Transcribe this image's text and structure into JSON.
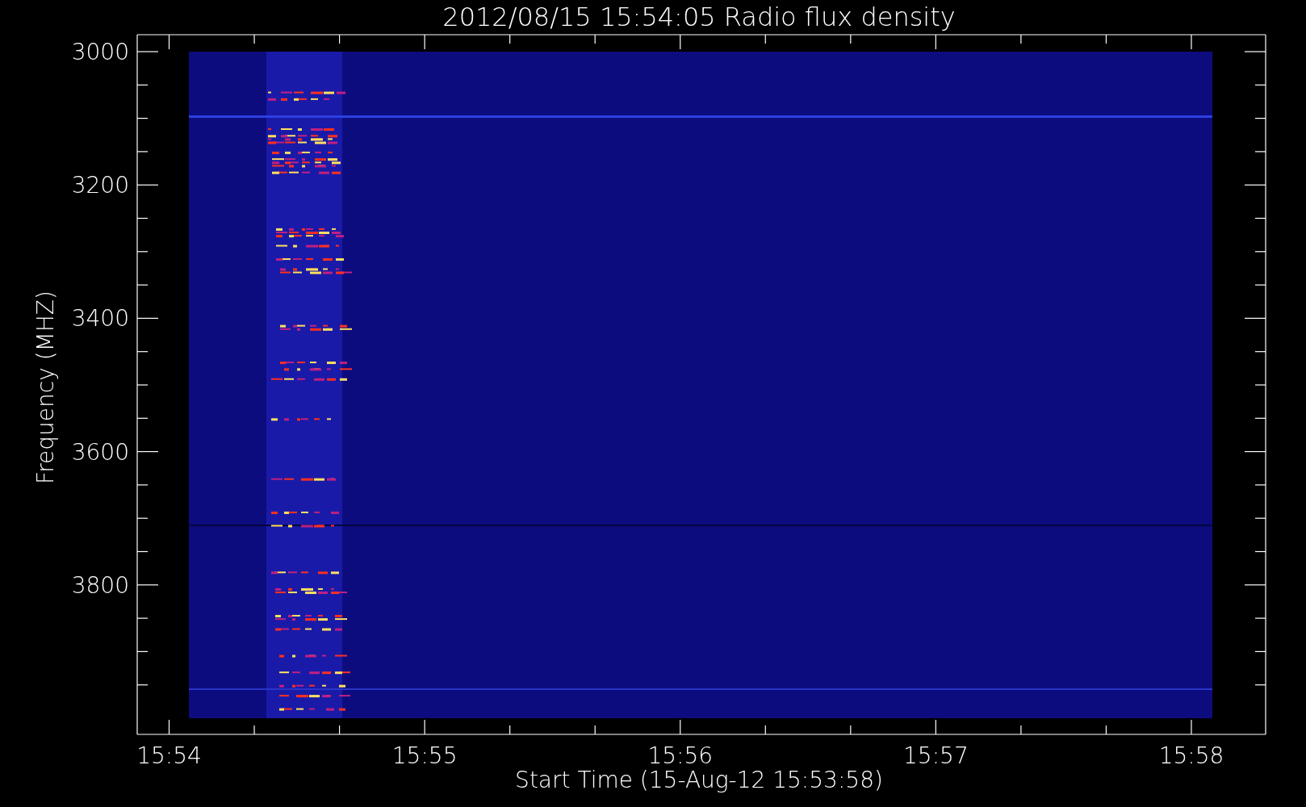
{
  "plot": {
    "title": "2012/08/15 15:54:05 Radio flux density",
    "xlabel": "Start Time (15-Aug-12 15:53:58)",
    "ylabel": "Frequency (MHZ)",
    "xticks": [
      "15:54",
      "15:55",
      "15:56",
      "15:57",
      "15:58"
    ],
    "yticks": [
      "3000",
      "3200",
      "3400",
      "3600",
      "3800"
    ]
  }
}
